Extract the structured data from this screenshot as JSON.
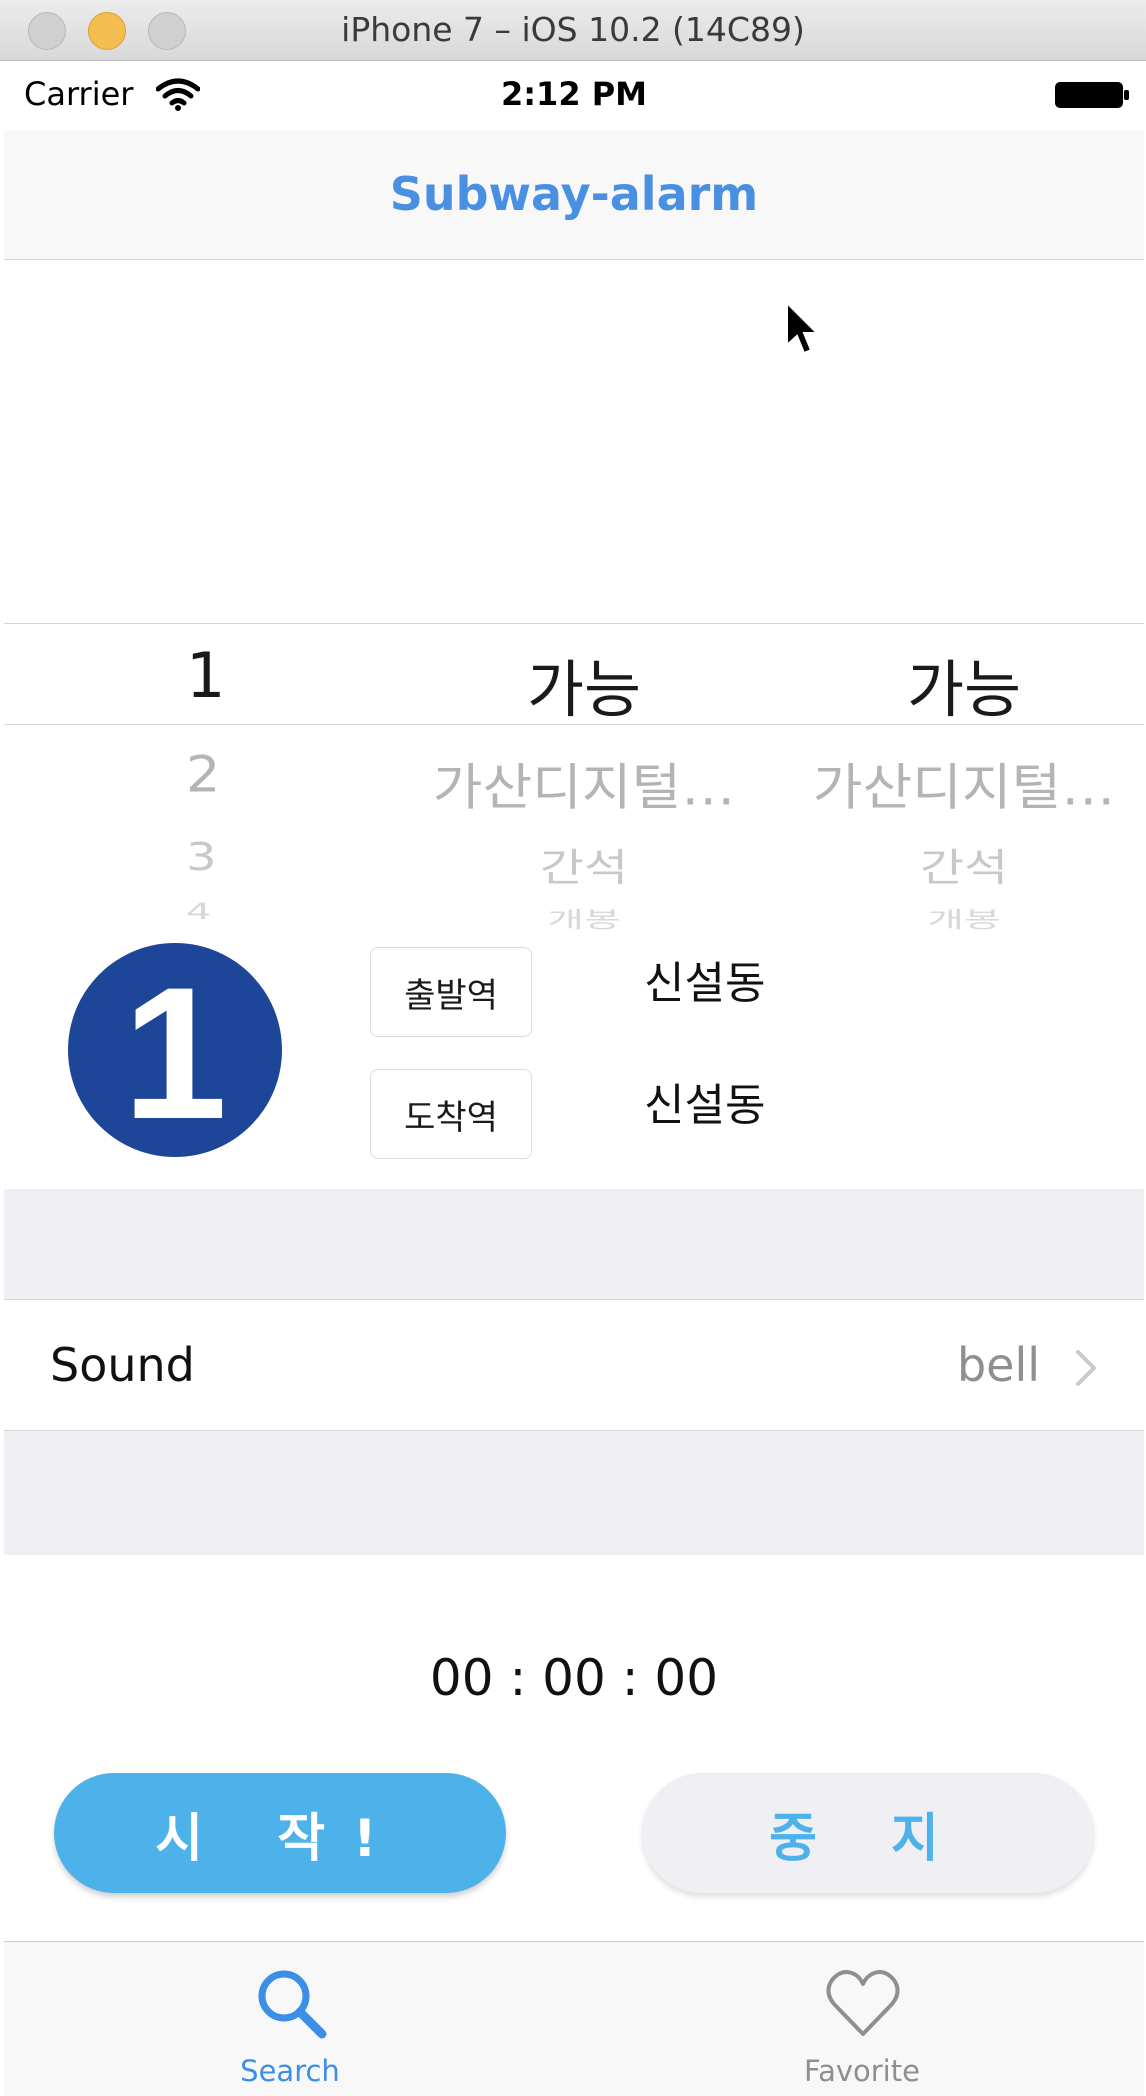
{
  "window": {
    "title": "iPhone 7 – iOS 10.2 (14C89)"
  },
  "status_bar": {
    "carrier": "Carrier",
    "time": "2:12 PM",
    "icons": [
      "wifi-icon",
      "battery-icon"
    ]
  },
  "nav": {
    "title": "Subway-alarm"
  },
  "picker": {
    "columns": [
      {
        "items": [
          "1",
          "2",
          "3",
          "4"
        ]
      },
      {
        "items": [
          "가능",
          "가산디지털…",
          "간석",
          "개봉"
        ]
      },
      {
        "items": [
          "가능",
          "가산디지털…",
          "간석",
          "개봉"
        ]
      }
    ]
  },
  "route": {
    "line_number": "1",
    "line_color": "#1d4598",
    "departure_label": "출발역",
    "departure_station": "신설동",
    "arrival_label": "도착역",
    "arrival_station": "신설동"
  },
  "sound": {
    "label": "Sound",
    "value": "bell"
  },
  "timer": {
    "display": "00 : 00 : 00"
  },
  "buttons": {
    "start": "시 작!",
    "stop": "중 지"
  },
  "tabs": [
    {
      "label": "Search",
      "icon": "search-icon",
      "selected": true
    },
    {
      "label": "Favorite",
      "icon": "heart-icon",
      "selected": false
    }
  ],
  "colors": {
    "accent": "#4a90e2",
    "button_blue": "#4db2ea",
    "group_background": "#efeff4"
  }
}
